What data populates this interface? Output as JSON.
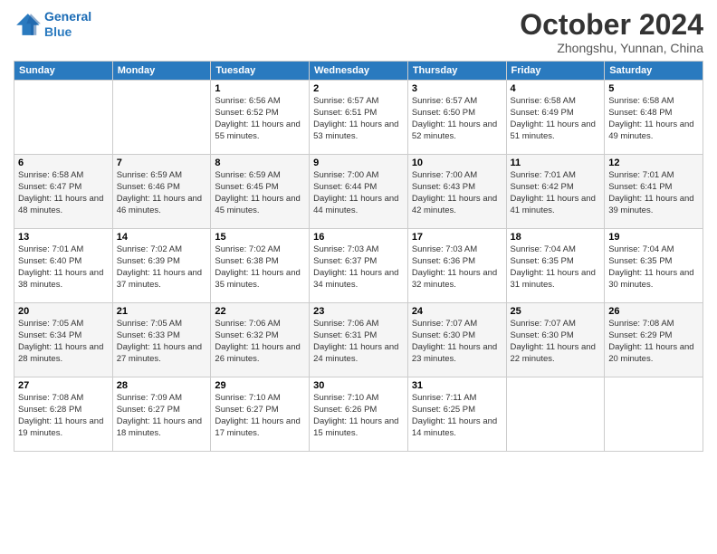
{
  "logo": {
    "line1": "General",
    "line2": "Blue"
  },
  "title": "October 2024",
  "location": "Zhongshu, Yunnan, China",
  "weekdays": [
    "Sunday",
    "Monday",
    "Tuesday",
    "Wednesday",
    "Thursday",
    "Friday",
    "Saturday"
  ],
  "weeks": [
    [
      {
        "day": null
      },
      {
        "day": null
      },
      {
        "day": "1",
        "sunrise": "6:56 AM",
        "sunset": "6:52 PM",
        "daylight": "11 hours and 55 minutes."
      },
      {
        "day": "2",
        "sunrise": "6:57 AM",
        "sunset": "6:51 PM",
        "daylight": "11 hours and 53 minutes."
      },
      {
        "day": "3",
        "sunrise": "6:57 AM",
        "sunset": "6:50 PM",
        "daylight": "11 hours and 52 minutes."
      },
      {
        "day": "4",
        "sunrise": "6:58 AM",
        "sunset": "6:49 PM",
        "daylight": "11 hours and 51 minutes."
      },
      {
        "day": "5",
        "sunrise": "6:58 AM",
        "sunset": "6:48 PM",
        "daylight": "11 hours and 49 minutes."
      }
    ],
    [
      {
        "day": "6",
        "sunrise": "6:58 AM",
        "sunset": "6:47 PM",
        "daylight": "11 hours and 48 minutes."
      },
      {
        "day": "7",
        "sunrise": "6:59 AM",
        "sunset": "6:46 PM",
        "daylight": "11 hours and 46 minutes."
      },
      {
        "day": "8",
        "sunrise": "6:59 AM",
        "sunset": "6:45 PM",
        "daylight": "11 hours and 45 minutes."
      },
      {
        "day": "9",
        "sunrise": "7:00 AM",
        "sunset": "6:44 PM",
        "daylight": "11 hours and 44 minutes."
      },
      {
        "day": "10",
        "sunrise": "7:00 AM",
        "sunset": "6:43 PM",
        "daylight": "11 hours and 42 minutes."
      },
      {
        "day": "11",
        "sunrise": "7:01 AM",
        "sunset": "6:42 PM",
        "daylight": "11 hours and 41 minutes."
      },
      {
        "day": "12",
        "sunrise": "7:01 AM",
        "sunset": "6:41 PM",
        "daylight": "11 hours and 39 minutes."
      }
    ],
    [
      {
        "day": "13",
        "sunrise": "7:01 AM",
        "sunset": "6:40 PM",
        "daylight": "11 hours and 38 minutes."
      },
      {
        "day": "14",
        "sunrise": "7:02 AM",
        "sunset": "6:39 PM",
        "daylight": "11 hours and 37 minutes."
      },
      {
        "day": "15",
        "sunrise": "7:02 AM",
        "sunset": "6:38 PM",
        "daylight": "11 hours and 35 minutes."
      },
      {
        "day": "16",
        "sunrise": "7:03 AM",
        "sunset": "6:37 PM",
        "daylight": "11 hours and 34 minutes."
      },
      {
        "day": "17",
        "sunrise": "7:03 AM",
        "sunset": "6:36 PM",
        "daylight": "11 hours and 32 minutes."
      },
      {
        "day": "18",
        "sunrise": "7:04 AM",
        "sunset": "6:35 PM",
        "daylight": "11 hours and 31 minutes."
      },
      {
        "day": "19",
        "sunrise": "7:04 AM",
        "sunset": "6:35 PM",
        "daylight": "11 hours and 30 minutes."
      }
    ],
    [
      {
        "day": "20",
        "sunrise": "7:05 AM",
        "sunset": "6:34 PM",
        "daylight": "11 hours and 28 minutes."
      },
      {
        "day": "21",
        "sunrise": "7:05 AM",
        "sunset": "6:33 PM",
        "daylight": "11 hours and 27 minutes."
      },
      {
        "day": "22",
        "sunrise": "7:06 AM",
        "sunset": "6:32 PM",
        "daylight": "11 hours and 26 minutes."
      },
      {
        "day": "23",
        "sunrise": "7:06 AM",
        "sunset": "6:31 PM",
        "daylight": "11 hours and 24 minutes."
      },
      {
        "day": "24",
        "sunrise": "7:07 AM",
        "sunset": "6:30 PM",
        "daylight": "11 hours and 23 minutes."
      },
      {
        "day": "25",
        "sunrise": "7:07 AM",
        "sunset": "6:30 PM",
        "daylight": "11 hours and 22 minutes."
      },
      {
        "day": "26",
        "sunrise": "7:08 AM",
        "sunset": "6:29 PM",
        "daylight": "11 hours and 20 minutes."
      }
    ],
    [
      {
        "day": "27",
        "sunrise": "7:08 AM",
        "sunset": "6:28 PM",
        "daylight": "11 hours and 19 minutes."
      },
      {
        "day": "28",
        "sunrise": "7:09 AM",
        "sunset": "6:27 PM",
        "daylight": "11 hours and 18 minutes."
      },
      {
        "day": "29",
        "sunrise": "7:10 AM",
        "sunset": "6:27 PM",
        "daylight": "11 hours and 17 minutes."
      },
      {
        "day": "30",
        "sunrise": "7:10 AM",
        "sunset": "6:26 PM",
        "daylight": "11 hours and 15 minutes."
      },
      {
        "day": "31",
        "sunrise": "7:11 AM",
        "sunset": "6:25 PM",
        "daylight": "11 hours and 14 minutes."
      },
      {
        "day": null
      },
      {
        "day": null
      }
    ]
  ]
}
